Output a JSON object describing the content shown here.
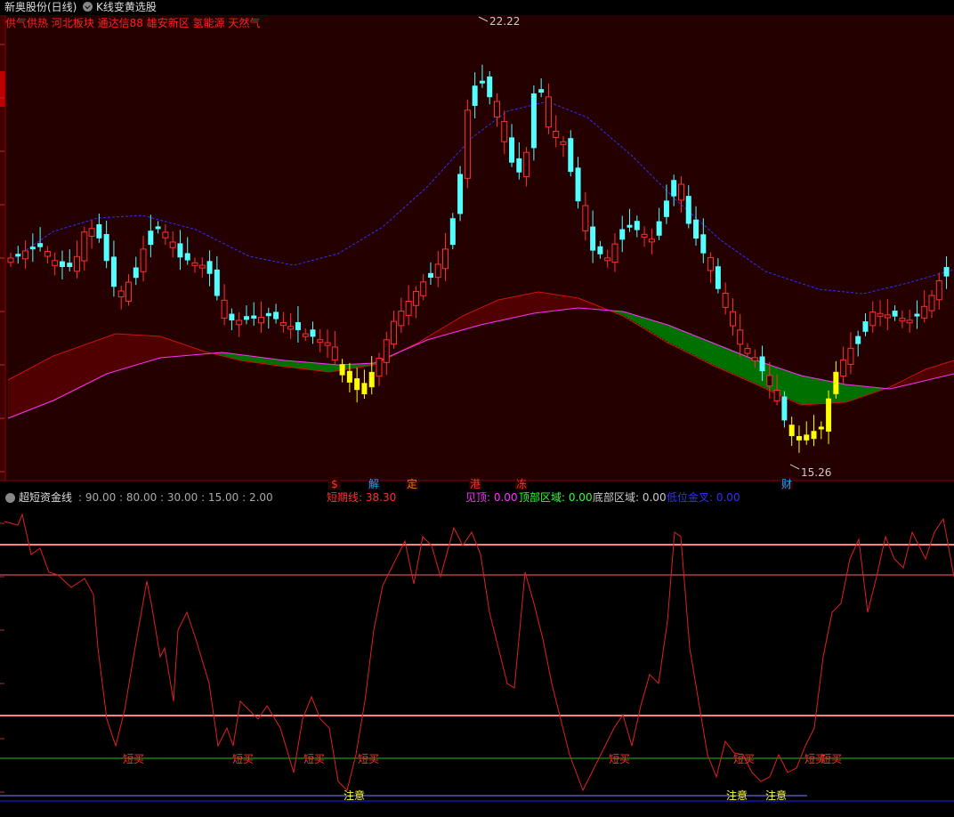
{
  "header": {
    "title": "新奥股份(日线)",
    "formula_name": "K线变黄选股",
    "concepts": "供气供热 河北板块 通达信88 雄安新区 氢能源 天然气"
  },
  "main_chart": {
    "high_label": "22.22",
    "low_label": "15.26",
    "event_markers": [
      {
        "text": "$",
        "color": "#ff3030"
      },
      {
        "text": "解",
        "color": "#00b0ff"
      },
      {
        "text": "定",
        "color": "#e08000"
      },
      {
        "text": "港",
        "color": "#ff3030"
      },
      {
        "text": "冻",
        "color": "#ff3030"
      },
      {
        "text": "财",
        "color": "#00b0ff"
      }
    ],
    "colors": {
      "up": "#ff3030",
      "down": "#54ffff",
      "yellow": "#ffff00",
      "fill_red": "#500000",
      "fill_green": "#007000",
      "dash_line": "#3030ff",
      "slow_line": "#ff30ff"
    }
  },
  "sub_chart": {
    "indicator_name": "超短资金线",
    "params": ": 90.00 : 80.00 : 30.00 : 15.00 : 2.00",
    "readouts": [
      {
        "label": "短期线: 38.30",
        "color": "#ff3030"
      },
      {
        "label": "见顶: 0.00",
        "color": "#ff30ff"
      },
      {
        "label": "顶部区域: 0.00",
        "color": "#30ff30"
      },
      {
        "label": "底部区域: 0.00",
        "color": "#cccccc"
      },
      {
        "label": "低位金叉: 0.00",
        "color": "#3030ff"
      }
    ],
    "buy_label": "短买",
    "caution_label": "注意"
  },
  "chart_data": {
    "type": "candlestick",
    "candles_ohlc_approx": [
      [
        17.9,
        18.4,
        17.2,
        17.6
      ],
      [
        17.6,
        18.5,
        17.4,
        18.1
      ],
      [
        18.1,
        18.3,
        17.5,
        17.7
      ],
      [
        17.7,
        18.3,
        17.5,
        18.2
      ],
      [
        18.2,
        18.6,
        17.8,
        18.0
      ],
      [
        18.0,
        18.4,
        17.4,
        17.6
      ],
      [
        17.6,
        18.2,
        17.3,
        18.0
      ],
      [
        18.0,
        18.4,
        17.6,
        17.8
      ],
      [
        17.8,
        18.0,
        17.3,
        17.5
      ],
      [
        17.5,
        17.8,
        17.2,
        17.7
      ],
      [
        17.7,
        18.9,
        17.5,
        18.7
      ],
      [
        18.7,
        19.2,
        18.3,
        18.4
      ],
      [
        18.4,
        18.8,
        18.0,
        18.6
      ],
      [
        18.6,
        18.8,
        17.5,
        17.8
      ],
      [
        17.8,
        18.0,
        16.8,
        17.2
      ]
    ],
    "indicator_levels": [
      90,
      80,
      30,
      15,
      2
    ],
    "short_line_last": 38.3
  }
}
